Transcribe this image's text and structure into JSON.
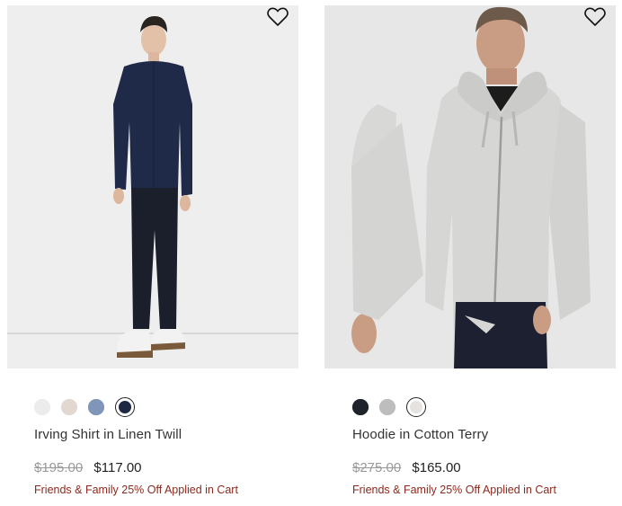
{
  "products": [
    {
      "name": "Irving Shirt in Linen Twill",
      "original_price": "$195.00",
      "sale_price": "$117.00",
      "promo": "Friends & Family 25% Off Applied in Cart",
      "swatches": [
        "#ececec",
        "#e2d8d0",
        "#7f96b8",
        "#1e2a44"
      ],
      "selected_swatch": 3,
      "image_icon": "model-wearing-navy-shirt-image"
    },
    {
      "name": "Hoodie in Cotton Terry",
      "original_price": "$275.00",
      "sale_price": "$165.00",
      "promo": "Friends & Family 25% Off Applied in Cart",
      "swatches": [
        "#1f232a",
        "#bdbdbd",
        "#e6e2de"
      ],
      "selected_swatch": 2,
      "image_icon": "model-wearing-grey-hoodie-image"
    }
  ],
  "wishlist_icon": "heart-icon"
}
